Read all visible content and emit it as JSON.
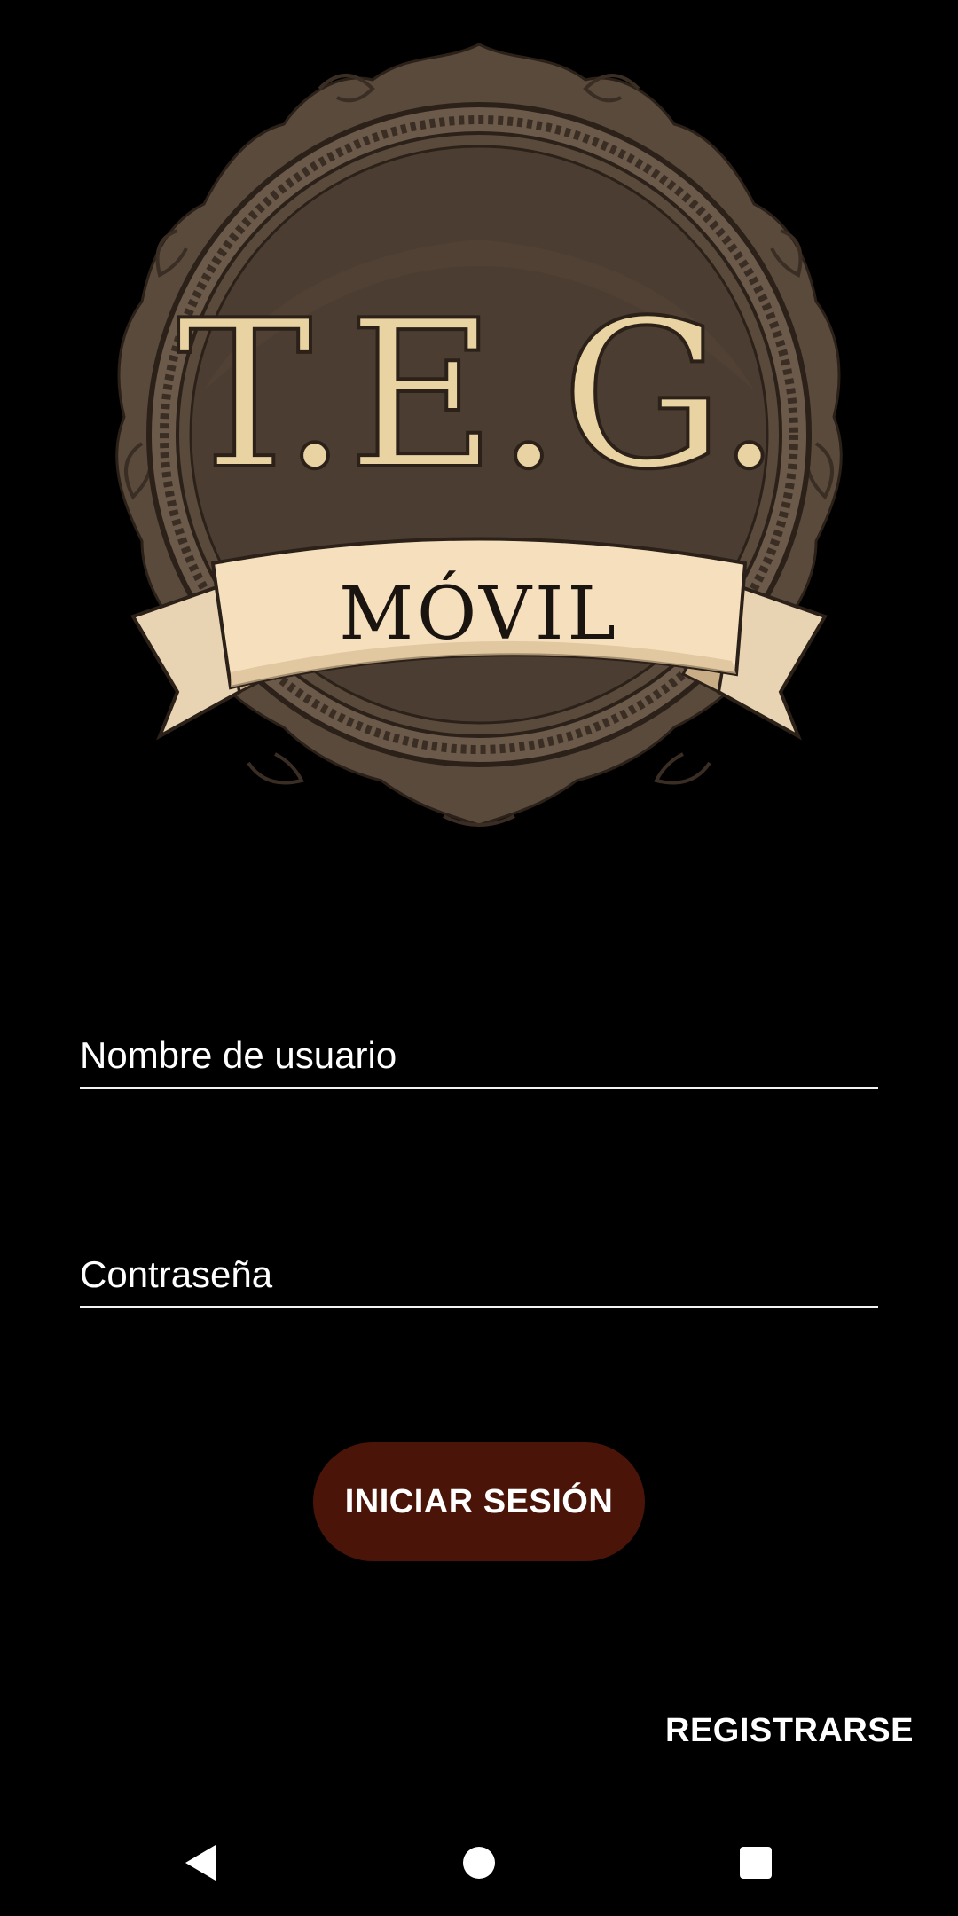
{
  "logo": {
    "title_text": "T.E.G.",
    "banner_text": "MÓVIL",
    "colors": {
      "frame": "#5a4a3c",
      "disc": "#4b3d31",
      "title": "#e9d3a2",
      "banner": "#f6dfbd",
      "banner_shadow": "#d9bd96"
    }
  },
  "form": {
    "username_placeholder": "Nombre de usuario",
    "password_placeholder": "Contraseña",
    "login_label": "INICIAR SESIÓN",
    "register_label": "REGISTRARSE"
  },
  "colors": {
    "background": "#000000",
    "accent_button": "#4a1508",
    "text": "#ffffff"
  },
  "navbar": {
    "icons": [
      "back-icon",
      "home-icon",
      "recents-icon"
    ]
  }
}
